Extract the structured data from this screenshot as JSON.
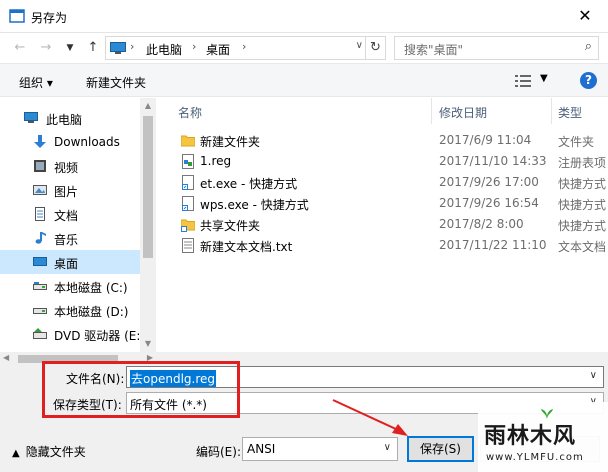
{
  "window": {
    "title": "另存为"
  },
  "address": {
    "crumbs": [
      "此电脑",
      "桌面"
    ],
    "search_placeholder": "搜索\"桌面\""
  },
  "toolbar": {
    "organize": "组织 ▾",
    "new_folder": "新建文件夹"
  },
  "nav": {
    "items": [
      {
        "label": "此电脑",
        "icon": "computer-icon"
      },
      {
        "label": "Downloads",
        "icon": "download-arrow-icon"
      },
      {
        "label": "视频",
        "icon": "video-icon"
      },
      {
        "label": "图片",
        "icon": "picture-icon"
      },
      {
        "label": "文档",
        "icon": "document-icon"
      },
      {
        "label": "音乐",
        "icon": "music-note-icon"
      },
      {
        "label": "桌面",
        "icon": "desktop-icon"
      },
      {
        "label": "本地磁盘 (C:)",
        "icon": "drive-icon"
      },
      {
        "label": "本地磁盘 (D:)",
        "icon": "drive-icon"
      },
      {
        "label": "DVD 驱动器 (E:)",
        "icon": "dvd-drive-icon"
      }
    ]
  },
  "columns": {
    "name": "名称",
    "date": "修改日期",
    "type": "类型"
  },
  "files": [
    {
      "name": "新建文件夹",
      "date": "2017/6/9 11:04",
      "type": "文件夹",
      "icon": "folder-icon"
    },
    {
      "name": "1.reg",
      "date": "2017/11/10 14:33",
      "type": "注册表项",
      "icon": "registry-file-icon"
    },
    {
      "name": "et.exe - 快捷方式",
      "date": "2017/9/26 17:00",
      "type": "快捷方式",
      "icon": "shortcut-icon"
    },
    {
      "name": "wps.exe - 快捷方式",
      "date": "2017/9/26 16:54",
      "type": "快捷方式",
      "icon": "shortcut-icon"
    },
    {
      "name": "共享文件夹",
      "date": "2017/8/2 8:00",
      "type": "快捷方式",
      "icon": "folder-shortcut-icon"
    },
    {
      "name": "新建文本文档.txt",
      "date": "2017/11/22 11:10",
      "type": "文本文档",
      "icon": "text-file-icon"
    }
  ],
  "form": {
    "filename_label": "文件名(N):",
    "filename_value": "去opendlg.reg",
    "filetype_label": "保存类型(T):",
    "filetype_value": "所有文件  (*.*)",
    "hide_folders": "隐藏文件夹",
    "encoding_label": "编码(E):",
    "encoding_value": "ANSI",
    "save_label": "保存(S)"
  },
  "watermark": {
    "brand": "雨林木风",
    "url": "www.YLMFU.com"
  },
  "colors": {
    "selection": "#cce8ff",
    "accent": "#0078d7",
    "annotation": "#e02020"
  }
}
